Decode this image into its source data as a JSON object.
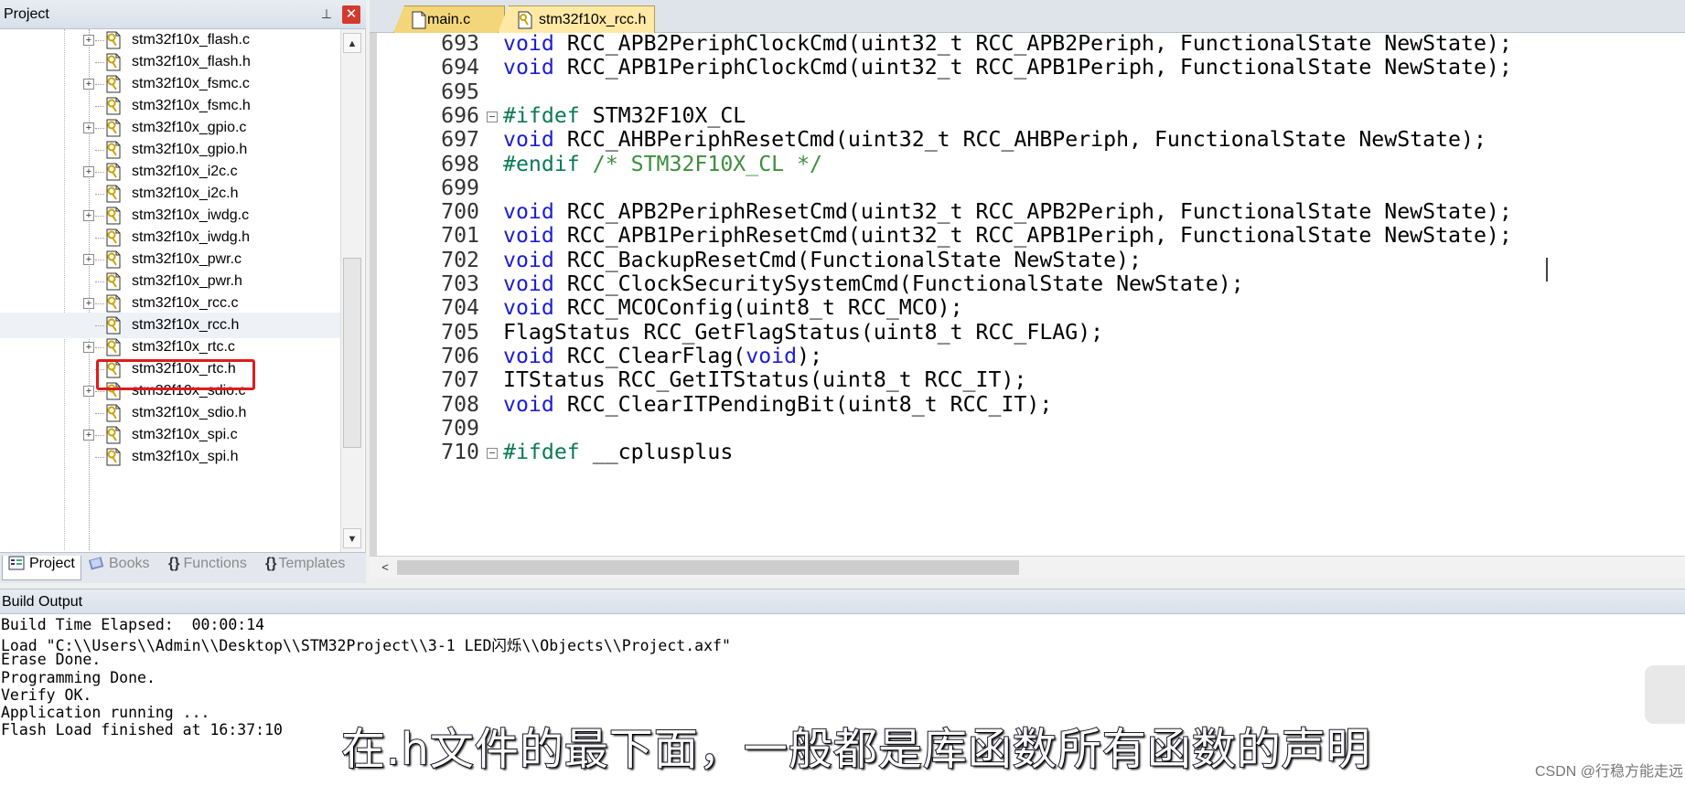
{
  "project_panel": {
    "title": "Project",
    "pin_glyph": "⊥",
    "close_glyph": "✕",
    "files": [
      {
        "name": "stm32f10x_flash.c",
        "expandable": true
      },
      {
        "name": "stm32f10x_flash.h",
        "expandable": false
      },
      {
        "name": "stm32f10x_fsmc.c",
        "expandable": true
      },
      {
        "name": "stm32f10x_fsmc.h",
        "expandable": false
      },
      {
        "name": "stm32f10x_gpio.c",
        "expandable": true
      },
      {
        "name": "stm32f10x_gpio.h",
        "expandable": false
      },
      {
        "name": "stm32f10x_i2c.c",
        "expandable": true
      },
      {
        "name": "stm32f10x_i2c.h",
        "expandable": false
      },
      {
        "name": "stm32f10x_iwdg.c",
        "expandable": true
      },
      {
        "name": "stm32f10x_iwdg.h",
        "expandable": false
      },
      {
        "name": "stm32f10x_pwr.c",
        "expandable": true
      },
      {
        "name": "stm32f10x_pwr.h",
        "expandable": false
      },
      {
        "name": "stm32f10x_rcc.c",
        "expandable": true
      },
      {
        "name": "stm32f10x_rcc.h",
        "expandable": false,
        "selected": true
      },
      {
        "name": "stm32f10x_rtc.c",
        "expandable": true
      },
      {
        "name": "stm32f10x_rtc.h",
        "expandable": false
      },
      {
        "name": "stm32f10x_sdio.c",
        "expandable": true
      },
      {
        "name": "stm32f10x_sdio.h",
        "expandable": false
      },
      {
        "name": "stm32f10x_spi.c",
        "expandable": true
      },
      {
        "name": "stm32f10x_spi.h",
        "expandable": false
      }
    ],
    "tabs": [
      {
        "label": "Project",
        "icon": "project-icon",
        "active": true
      },
      {
        "label": "Books",
        "icon": "books-icon",
        "active": false
      },
      {
        "label": "Functions",
        "icon": "functions-icon",
        "active": false
      },
      {
        "label": "Templates",
        "icon": "templates-icon",
        "active": false
      }
    ]
  },
  "editor": {
    "tabs": [
      {
        "label": "main.c",
        "active": false
      },
      {
        "label": "stm32f10x_rcc.h",
        "active": true
      }
    ],
    "lines": [
      {
        "no": "693",
        "fold": "",
        "parts": [
          [
            "kw",
            "void"
          ],
          [
            "",
            "RCC_APB2PeriphClockCmd(uint32_t RCC_APB2Periph, FunctionalState NewState);"
          ]
        ]
      },
      {
        "no": "694",
        "fold": "",
        "parts": [
          [
            "kw",
            "void"
          ],
          [
            "",
            "RCC_APB1PeriphClockCmd(uint32_t RCC_APB1Periph, FunctionalState NewState);"
          ]
        ]
      },
      {
        "no": "695",
        "fold": "",
        "parts": []
      },
      {
        "no": "696",
        "fold": "−",
        "parts": [
          [
            "pp",
            "#ifdef"
          ],
          [
            "",
            "STM32F10X_CL"
          ]
        ]
      },
      {
        "no": "697",
        "fold": "",
        "parts": [
          [
            "kw",
            "void"
          ],
          [
            "",
            "RCC_AHBPeriphResetCmd(uint32_t RCC_AHBPeriph, FunctionalState NewState);"
          ]
        ]
      },
      {
        "no": "698",
        "fold": "",
        "parts": [
          [
            "pp",
            "#endif"
          ],
          [
            "cm",
            "/* STM32F10X_CL */"
          ]
        ]
      },
      {
        "no": "699",
        "fold": "",
        "parts": []
      },
      {
        "no": "700",
        "fold": "",
        "parts": [
          [
            "kw",
            "void"
          ],
          [
            "",
            "RCC_APB2PeriphResetCmd(uint32_t RCC_APB2Periph, FunctionalState NewState);"
          ]
        ]
      },
      {
        "no": "701",
        "fold": "",
        "parts": [
          [
            "kw",
            "void"
          ],
          [
            "",
            "RCC_APB1PeriphResetCmd(uint32_t RCC_APB1Periph, FunctionalState NewState);"
          ]
        ]
      },
      {
        "no": "702",
        "fold": "",
        "parts": [
          [
            "kw",
            "void"
          ],
          [
            "",
            "RCC_BackupResetCmd(FunctionalState NewState);"
          ]
        ]
      },
      {
        "no": "703",
        "fold": "",
        "parts": [
          [
            "kw",
            "void"
          ],
          [
            "",
            "RCC_ClockSecuritySystemCmd(FunctionalState NewState);"
          ]
        ]
      },
      {
        "no": "704",
        "fold": "",
        "parts": [
          [
            "kw",
            "void"
          ],
          [
            "",
            "RCC_MCOConfig(uint8_t RCC_MCO);"
          ]
        ]
      },
      {
        "no": "705",
        "fold": "",
        "parts": [
          [
            "",
            "FlagStatus RCC_GetFlagStatus(uint8_t RCC_FLAG);"
          ]
        ]
      },
      {
        "no": "706",
        "fold": "",
        "parts": [
          [
            "kw",
            "void"
          ],
          [
            "",
            "RCC_ClearFlag("
          ],
          [
            "kw",
            "void"
          ],
          [
            "",
            ");"
          ]
        ]
      },
      {
        "no": "707",
        "fold": "",
        "parts": [
          [
            "",
            "ITStatus RCC_GetITStatus(uint8_t RCC_IT);"
          ]
        ]
      },
      {
        "no": "708",
        "fold": "",
        "parts": [
          [
            "kw",
            "void"
          ],
          [
            "",
            "RCC_ClearITPendingBit(uint8_t RCC_IT);"
          ]
        ]
      },
      {
        "no": "709",
        "fold": "",
        "parts": []
      },
      {
        "no": "710",
        "fold": "−",
        "parts": [
          [
            "pp",
            "#ifdef"
          ],
          [
            "",
            "__cplusplus"
          ]
        ]
      }
    ]
  },
  "build_output": {
    "title": "Build Output",
    "lines": [
      "Build Time Elapsed:  00:00:14",
      "Load \"C:\\\\Users\\\\Admin\\\\Desktop\\\\STM32Project\\\\3-1 LED闪烁\\\\Objects\\\\Project.axf\"",
      "Erase Done.",
      "Programming Done.",
      "Verify OK.",
      "Application running ...",
      "Flash Load finished at 16:37:10"
    ]
  },
  "subtitle": "在.h文件的最下面，一般都是库函数所有函数的声明",
  "watermark": "CSDN @行稳方能走远",
  "colors": {
    "keyword": "#1c1cd6",
    "preprocessor": "#0a7a52",
    "comment": "#3d8e3d",
    "highlight_box": "#e01b1b",
    "tab_active": "#ffe9a5"
  }
}
